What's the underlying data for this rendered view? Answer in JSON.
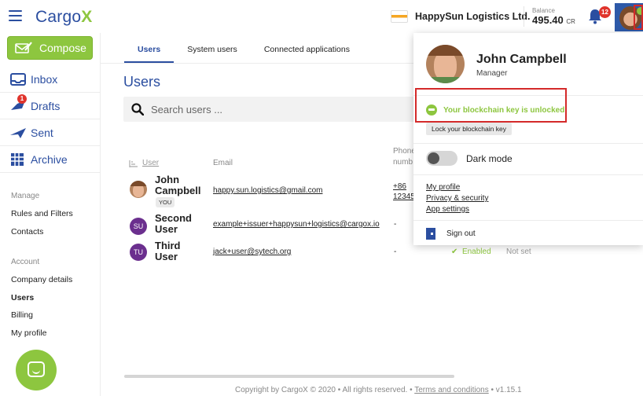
{
  "header": {
    "logo_text": "Cargo",
    "logo_accent": "X",
    "company_name": "HappySun Logistics Ltd.",
    "balance_label": "Balance",
    "balance_amount": "495.40",
    "balance_unit": "CR",
    "notification_count": "12"
  },
  "sidebar": {
    "compose_label": "Compose",
    "nav": [
      {
        "label": "Inbox",
        "icon": "inbox-icon"
      },
      {
        "label": "Drafts",
        "icon": "drafts-icon",
        "badge": "1"
      },
      {
        "label": "Sent",
        "icon": "sent-icon"
      },
      {
        "label": "Archive",
        "icon": "archive-icon"
      }
    ],
    "manage_label": "Manage",
    "manage_links": [
      "Rules and Filters",
      "Contacts"
    ],
    "account_label": "Account",
    "account_links": [
      "Company details",
      "Users",
      "Billing",
      "My profile"
    ],
    "active_link": "Users"
  },
  "main": {
    "tabs": [
      "Users",
      "System users",
      "Connected applications"
    ],
    "active_tab": "Users",
    "title": "Users",
    "search_placeholder": "Search users ...",
    "columns": {
      "user": "User",
      "email": "Email",
      "phone": "Phone numb"
    },
    "rows": [
      {
        "initials": "",
        "name_line1": "John",
        "name_line2": "Campbell",
        "badge": "YOU",
        "email": "happy.sun.logistics@gmail.com",
        "phone_line1": "+86",
        "phone_line2": "12345"
      },
      {
        "initials": "SU",
        "name_line1": "Second",
        "name_line2": "User",
        "email": "example+issuer+happysun+logistics@cargox.io",
        "phone": "-"
      },
      {
        "initials": "TU",
        "name_line1": "Third",
        "name_line2": "User",
        "email": "jack+user@sytech.org",
        "phone": "-"
      }
    ],
    "status_enabled": "Enabled",
    "status_not_set": "Not set",
    "footer_text": "Copyright by CargoX © 2020 • All rights reserved. •",
    "footer_link": "Terms and conditions",
    "footer_version": "• v1.15.1"
  },
  "profile_panel": {
    "name": "John Campbell",
    "role": "Manager",
    "key_status": "Your blockchain key is unlocked",
    "lock_label": "Lock your blockchain key",
    "dark_mode_label": "Dark mode",
    "dark_mode_on": false,
    "links": [
      "My profile",
      "Privacy & security",
      "App settings"
    ],
    "sign_out_label": "Sign out"
  },
  "colors": {
    "brand_blue": "#2b4ea0",
    "brand_green": "#8dc63f",
    "highlight_red": "#d42a2a",
    "su_avatar": "#6b2f8e",
    "tu_avatar": "#6b2f8e"
  }
}
